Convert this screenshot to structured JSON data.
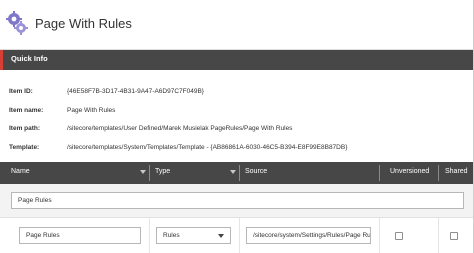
{
  "header": {
    "title": "Page With Rules",
    "icon": "template-gears-icon"
  },
  "quick_info": {
    "label": "Quick Info",
    "accent_color": "#d83f34",
    "rows": [
      {
        "key": "Item ID:",
        "value": "{46E58F7B-3D17-4B31-9A47-A6D97C7F049B}"
      },
      {
        "key": "Item name:",
        "value": "Page With Rules"
      },
      {
        "key": "Item path:",
        "value": "/sitecore/templates/User Defined/Marek Musielak PageRules/Page With Rules"
      },
      {
        "key": "Template:",
        "value": "/sitecore/templates/System/Templates/Template - {AB86861A-6030-46C5-B394-E8F99E8B87DB}"
      }
    ]
  },
  "grid": {
    "columns": {
      "name": "Name",
      "type": "Type",
      "source": "Source",
      "unversioned": "Unversioned",
      "shared": "Shared"
    },
    "section_name": "Page Rules",
    "fields": [
      {
        "name": "Page Rules",
        "type": "Rules",
        "source": "/sitecore/system/Settings/Rules/Page Rules",
        "unversioned": false,
        "shared": false
      }
    ]
  }
}
